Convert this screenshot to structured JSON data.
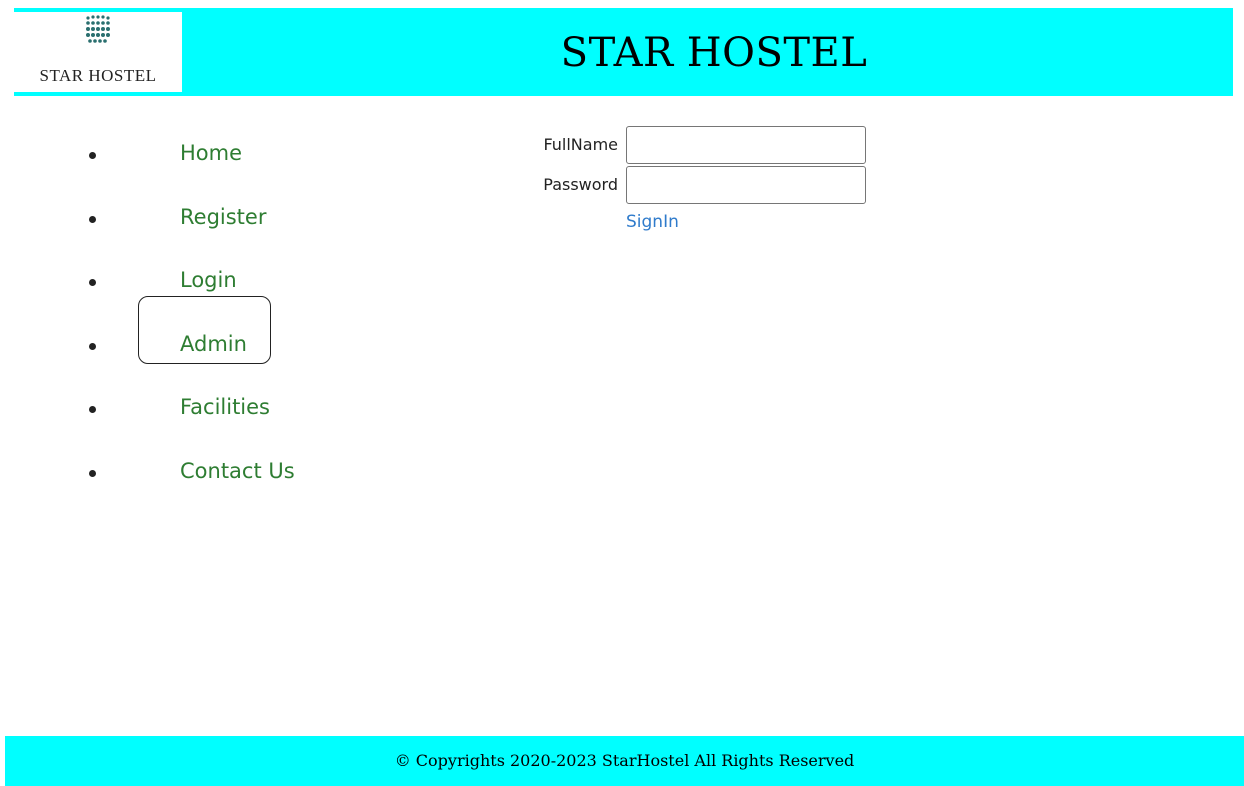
{
  "header": {
    "title": "STAR HOSTEL",
    "logo_text": "STAR HOSTEL",
    "logo_icon": "dot-grid-logo-icon",
    "background_color": "#00ffff"
  },
  "nav": {
    "items": [
      {
        "label": "Home"
      },
      {
        "label": "Register"
      },
      {
        "label": "Login"
      },
      {
        "label": "Admin"
      },
      {
        "label": "Facilities"
      },
      {
        "label": "Contact Us"
      }
    ],
    "highlighted_item": "Admin",
    "link_color": "#2e7d32"
  },
  "login_form": {
    "fullname_label": "FullName",
    "fullname_value": "",
    "password_label": "Password",
    "password_value": "",
    "signin_label": "SignIn",
    "signin_color": "#2f7bcb"
  },
  "footer": {
    "text": "© Copyrights 2020-2023 StarHostel All Rights Reserved",
    "background_color": "#00ffff"
  }
}
